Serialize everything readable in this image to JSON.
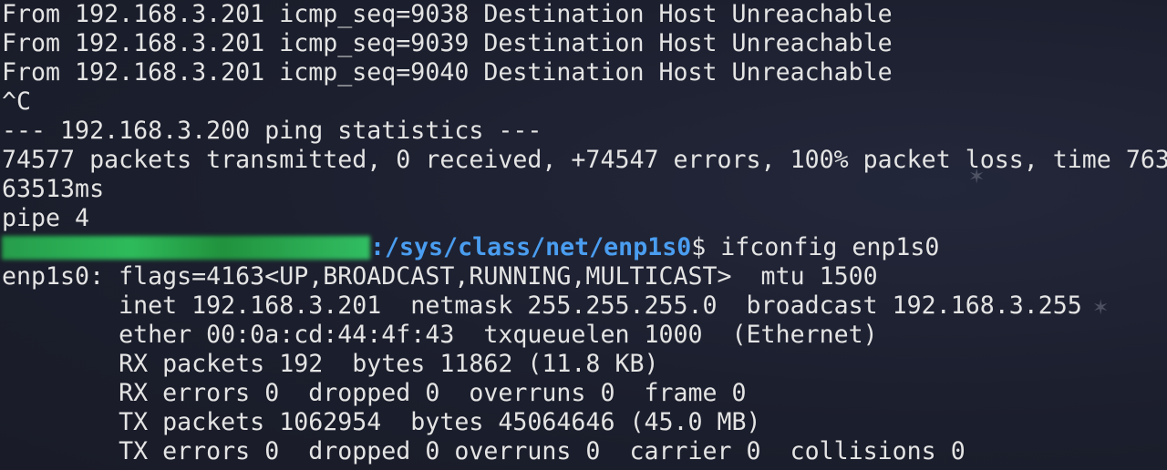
{
  "terminal": {
    "lines_top": [
      "From 192.168.3.201 icmp_seq=9038 Destination Host Unreachable",
      "From 192.168.3.201 icmp_seq=9039 Destination Host Unreachable",
      "From 192.168.3.201 icmp_seq=9040 Destination Host Unreachable",
      "^C",
      "--- 192.168.3.200 ping statistics ---",
      "74577 packets transmitted, 0 received, +74547 errors, 100% packet loss, time 763",
      "63513ms",
      "pipe 4"
    ],
    "prompt": {
      "path": ":/sys/class/net/enp1s0",
      "symbol": "$ ",
      "command": "ifconfig enp1s0"
    },
    "lines_bottom": [
      "enp1s0: flags=4163<UP,BROADCAST,RUNNING,MULTICAST>  mtu 1500",
      "        inet 192.168.3.201  netmask 255.255.255.0  broadcast 192.168.3.255",
      "        ether 00:0a:cd:44:4f:43  txqueuelen 1000  (Ethernet)",
      "        RX packets 192  bytes 11862 (11.8 KB)",
      "        RX errors 0  dropped 0  overruns 0  frame 0",
      "        TX packets 1062954  bytes 45064646 (45.0 MB)",
      "        TX errors 0  dropped 0 overruns 0  carrier 0  collisions 0"
    ]
  },
  "colors": {
    "background": "#1c1f2e",
    "text": "#e4e4e4",
    "path": "#4a9df0",
    "redacted": "#2fc45e"
  }
}
